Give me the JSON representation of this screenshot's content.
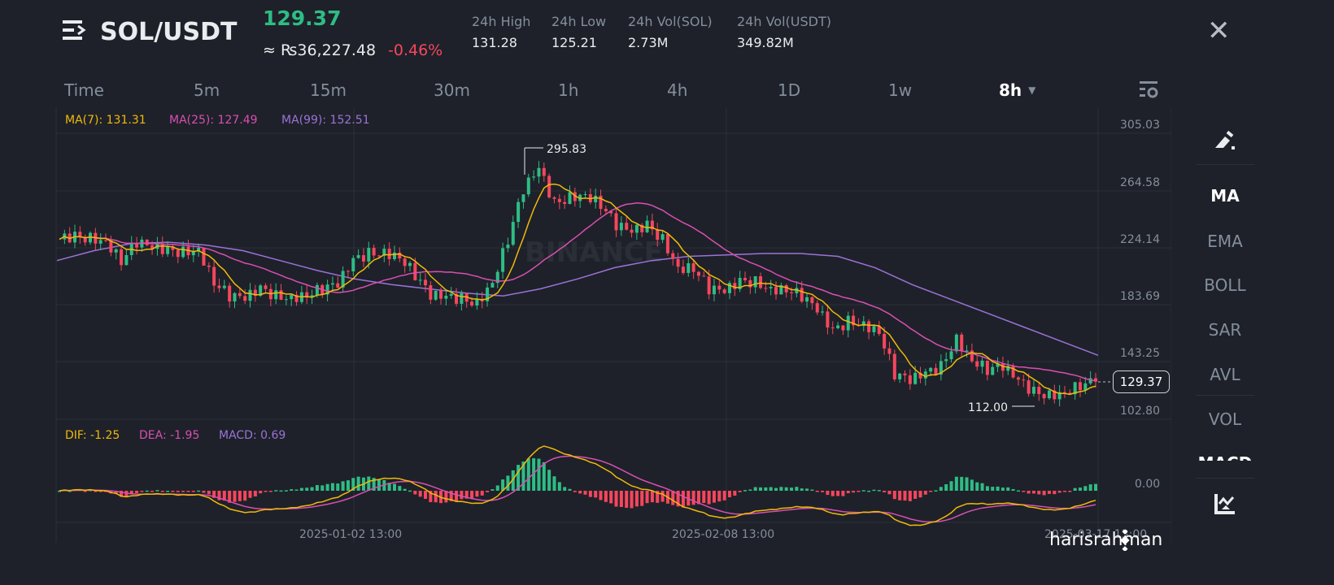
{
  "header": {
    "pair": "SOL/USDT",
    "last_price": "129.37",
    "approx_local": "≈ ₨36,227.48",
    "change": "-0.46%",
    "stats": [
      {
        "label": "24h High",
        "value": "131.28"
      },
      {
        "label": "24h Low",
        "value": "125.21"
      },
      {
        "label": "24h Vol(SOL)",
        "value": "2.73M"
      },
      {
        "label": "24h Vol(USDT)",
        "value": "349.82M"
      }
    ],
    "close_icon": "close-icon",
    "menu_icon": "menu-icon"
  },
  "timeframes": [
    {
      "label": "Time"
    },
    {
      "label": "5m"
    },
    {
      "label": "15m"
    },
    {
      "label": "30m"
    },
    {
      "label": "1h"
    },
    {
      "label": "4h"
    },
    {
      "label": "1D"
    },
    {
      "label": "1w"
    },
    {
      "label": "8h",
      "active": true
    }
  ],
  "legend": {
    "ma7": "MA(7): 131.31",
    "ma25": "MA(25): 127.49",
    "ma99": "MA(99): 152.51",
    "dif": "DIF: -1.25",
    "dea": "DEA: -1.95",
    "macd": "MACD: 0.69"
  },
  "side_panel": {
    "items": [
      "MA",
      "EMA",
      "BOLL",
      "SAR",
      "AVL",
      "VOL",
      "MACD"
    ],
    "active": "MA"
  },
  "colors": {
    "up": "#2ebd85",
    "down": "#f6465d",
    "ma7": "#f0b90b",
    "ma25": "#d94fb3",
    "ma99": "#9b72d9",
    "bg": "#1e2129"
  },
  "watermark": "BINANCE",
  "credit": "harisrahman",
  "chart_data": {
    "type": "candlestick",
    "y_ticks": [
      "305.03",
      "264.58",
      "224.14",
      "183.69",
      "143.25",
      "102.80"
    ],
    "ylim": [
      102.8,
      305.03
    ],
    "x_labels": [
      "2025-01-02 13:00",
      "2025-02-08 13:00",
      "2025-03-17 13:00"
    ],
    "macd_tick": "0.00",
    "max_label": "295.83",
    "min_label": "112.00",
    "last_price": "129.37",
    "closes": [
      230,
      232,
      231,
      229,
      215,
      228,
      224,
      222,
      221,
      223,
      200,
      190,
      188,
      195,
      190,
      189,
      191,
      195,
      198,
      215,
      220,
      221,
      218,
      205,
      190,
      189,
      188,
      185,
      200,
      230,
      265,
      280,
      255,
      260,
      262,
      255,
      240,
      235,
      240,
      230,
      210,
      210,
      195,
      193,
      200,
      200,
      195,
      195,
      190,
      180,
      165,
      172,
      170,
      165,
      135,
      130,
      135,
      140,
      160,
      145,
      138,
      140,
      130,
      122,
      120,
      122,
      127,
      129.37
    ],
    "ma99": [
      215,
      222,
      227,
      228,
      226,
      222,
      215,
      208,
      202,
      198,
      195,
      192,
      190,
      195,
      202,
      210,
      215,
      218,
      219,
      220,
      220,
      218,
      210,
      198,
      188,
      178,
      168,
      158,
      148
    ]
  }
}
